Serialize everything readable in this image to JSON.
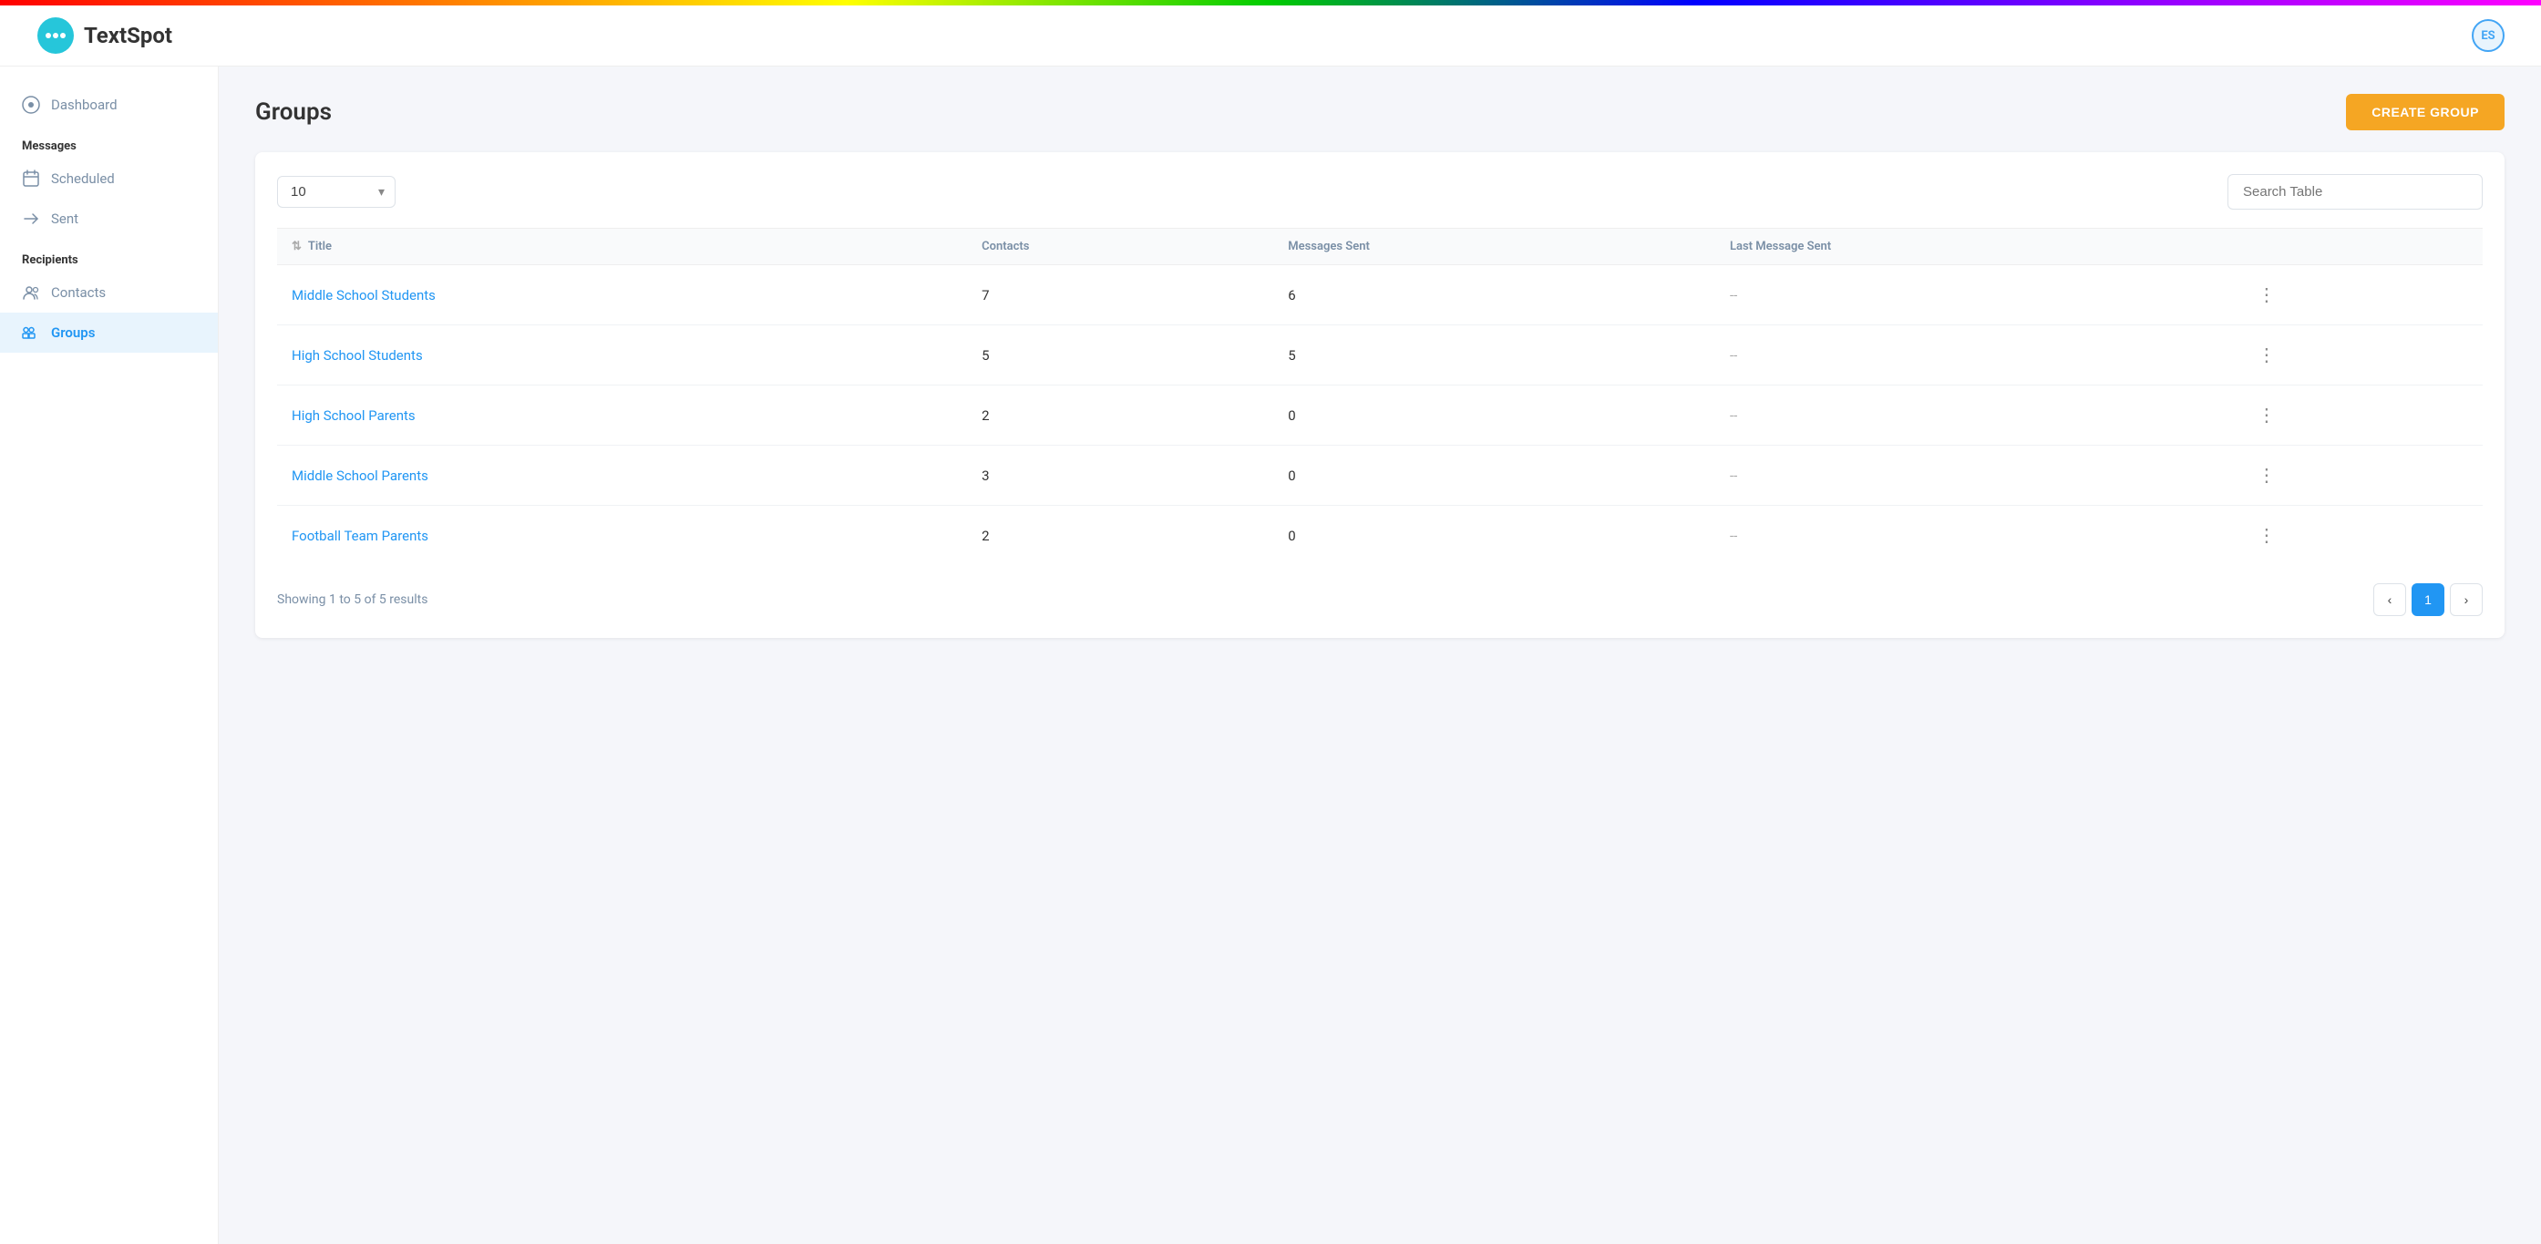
{
  "rainbow_bar": true,
  "header": {
    "logo_text": "TextSpot",
    "user_initials": "ES"
  },
  "sidebar": {
    "sections": [
      {
        "label": "",
        "items": [
          {
            "id": "dashboard",
            "label": "Dashboard",
            "icon": "💬",
            "active": false
          }
        ]
      },
      {
        "label": "Messages",
        "items": [
          {
            "id": "scheduled",
            "label": "Scheduled",
            "icon": "📅",
            "active": false
          },
          {
            "id": "sent",
            "label": "Sent",
            "icon": "📤",
            "active": false
          }
        ]
      },
      {
        "label": "Recipients",
        "items": [
          {
            "id": "contacts",
            "label": "Contacts",
            "icon": "👥",
            "active": false
          },
          {
            "id": "groups",
            "label": "Groups",
            "icon": "👤",
            "active": true
          }
        ]
      }
    ]
  },
  "page": {
    "title": "Groups",
    "create_button_label": "CREATE GROUP"
  },
  "table": {
    "per_page_value": "10",
    "search_placeholder": "Search Table",
    "columns": [
      {
        "id": "title",
        "label": "Title",
        "sortable": true
      },
      {
        "id": "contacts",
        "label": "Contacts",
        "sortable": false
      },
      {
        "id": "messages_sent",
        "label": "Messages Sent",
        "sortable": false
      },
      {
        "id": "last_message_sent",
        "label": "Last Message Sent",
        "sortable": false
      }
    ],
    "rows": [
      {
        "id": 1,
        "title": "Middle School Students",
        "contacts": 7,
        "messages_sent": 6,
        "last_message_sent": "--"
      },
      {
        "id": 2,
        "title": "High School Students",
        "contacts": 5,
        "messages_sent": 5,
        "last_message_sent": "--"
      },
      {
        "id": 3,
        "title": "High School Parents",
        "contacts": 2,
        "messages_sent": 0,
        "last_message_sent": "--"
      },
      {
        "id": 4,
        "title": "Middle School Parents",
        "contacts": 3,
        "messages_sent": 0,
        "last_message_sent": "--"
      },
      {
        "id": 5,
        "title": "Football Team Parents",
        "contacts": 2,
        "messages_sent": 0,
        "last_message_sent": "--"
      }
    ],
    "showing_text": "Showing 1 to 5 of 5 results",
    "pagination": {
      "prev_label": "‹",
      "next_label": "›",
      "current_page": 1,
      "pages": [
        1
      ]
    }
  }
}
